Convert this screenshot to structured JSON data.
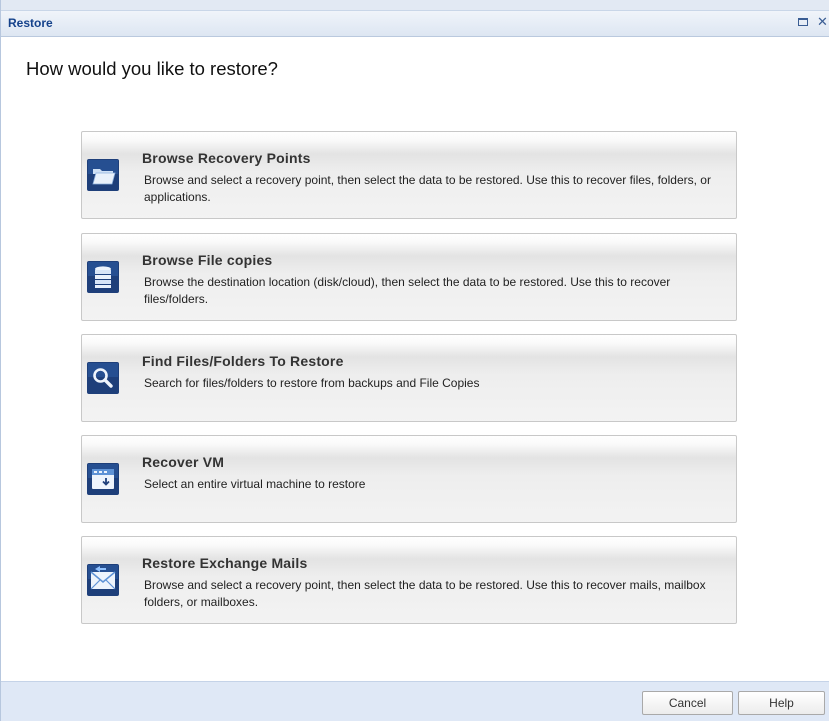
{
  "window": {
    "title": "Restore"
  },
  "heading": "How would you like to restore?",
  "options": [
    {
      "title": "Browse Recovery Points",
      "description": "Browse and select a recovery point, then select the data to be restored. Use this to recover files, folders, or applications.",
      "icon": "folder-icon"
    },
    {
      "title": "Browse File copies",
      "description": "Browse the destination location (disk/cloud), then select the data to be restored. Use this to recover files/folders.",
      "icon": "database-stack-icon"
    },
    {
      "title": "Find Files/Folders To Restore",
      "description": "Search for files/folders to restore from backups and File Copies",
      "icon": "magnifier-icon"
    },
    {
      "title": "Recover VM",
      "description": "Select an entire virtual machine to restore",
      "icon": "virtual-machine-icon"
    },
    {
      "title": "Restore Exchange Mails",
      "description": "Browse and select a recovery point, then select the data to be restored. Use this to recover mails, mailbox folders, or mailboxes.",
      "icon": "mail-restore-icon"
    }
  ],
  "footer": {
    "cancel_label": "Cancel",
    "help_label": "Help"
  },
  "colors": {
    "title_text": "#15428b",
    "icon_dark": "#1e3f7a",
    "icon_light": "#5f93d6",
    "footer_bg": "#dfe8f6"
  }
}
